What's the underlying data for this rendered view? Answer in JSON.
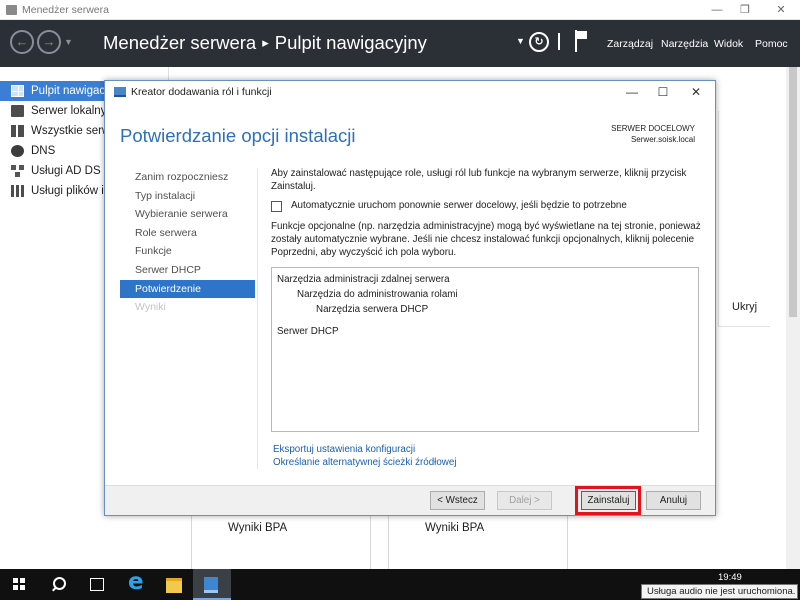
{
  "server_manager": {
    "window_title": "Menedżer serwera",
    "breadcrumb": {
      "root": "Menedżer serwera",
      "separator": "▸",
      "current": "Pulpit nawigacyjny"
    },
    "menu": [
      "Zarządzaj",
      "Narzędzia",
      "Widok",
      "Pomoc"
    ],
    "sidebar": [
      {
        "label": "Pulpit nawigacyjny",
        "icon": "dashboard-icon",
        "active": true
      },
      {
        "label": "Serwer lokalny",
        "icon": "server-icon",
        "active": false
      },
      {
        "label": "Wszystkie serwery",
        "icon": "servers-icon",
        "active": false
      },
      {
        "label": "DNS",
        "icon": "dns-icon",
        "active": false
      },
      {
        "label": "Usługi AD DS",
        "icon": "adds-icon",
        "active": false
      },
      {
        "label": "Usługi plików i magazynowania",
        "icon": "file-services-icon",
        "active": false
      }
    ],
    "hide_label": "Ukryj",
    "bpa_tiles": [
      "Wyniki BPA",
      "Wyniki BPA"
    ]
  },
  "wizard": {
    "title": "Kreator dodawania ról i funkcji",
    "heading": "Potwierdzanie opcji instalacji",
    "target_label": "SERWER DOCELOWY",
    "target_value": "Serwer.soisk.local",
    "steps": [
      {
        "label": "Zanim rozpoczniesz",
        "state": "normal"
      },
      {
        "label": "Typ instalacji",
        "state": "normal"
      },
      {
        "label": "Wybieranie serwera",
        "state": "normal"
      },
      {
        "label": "Role serwera",
        "state": "normal"
      },
      {
        "label": "Funkcje",
        "state": "normal"
      },
      {
        "label": "Serwer DHCP",
        "state": "normal"
      },
      {
        "label": "Potwierdzenie",
        "state": "active"
      },
      {
        "label": "Wyniki",
        "state": "disabled"
      }
    ],
    "intro_text": "Aby zainstalować następujące role, usługi ról lub funkcje na wybranym serwerze, kliknij przycisk Zainstaluj.",
    "restart_checkbox": {
      "label": "Automatycznie uruchom ponownie serwer docelowy, jeśli będzie to potrzebne",
      "checked": false
    },
    "optional_text": "Funkcje opcjonalne (np. narzędzia administracyjne) mogą być wyświetlane na tej stronie, ponieważ zostały automatycznie wybrane. Jeśli nie chcesz instalować funkcji opcjonalnych, kliknij polecenie Poprzedni, aby wyczyścić ich pola wyboru.",
    "selections": [
      {
        "label": "Narzędzia administracji zdalnej serwera",
        "level": 0
      },
      {
        "label": "Narzędzia do administrowania rolami",
        "level": 1
      },
      {
        "label": "Narzędzia serwera DHCP",
        "level": 2
      },
      {
        "label": "Serwer DHCP",
        "level": 0
      }
    ],
    "links": {
      "export": "Eksportuj ustawienia konfiguracji",
      "alt_source": "Określanie alternatywnej ścieżki źródłowej"
    },
    "buttons": {
      "previous": "< Wstecz",
      "next": "Dalej >",
      "install": "Zainstaluj",
      "cancel": "Anuluj"
    },
    "highlight_color": "#e0141e"
  },
  "taskbar": {
    "time": "19:49",
    "tooltip": "Usługa audio nie jest uruchomiona."
  }
}
